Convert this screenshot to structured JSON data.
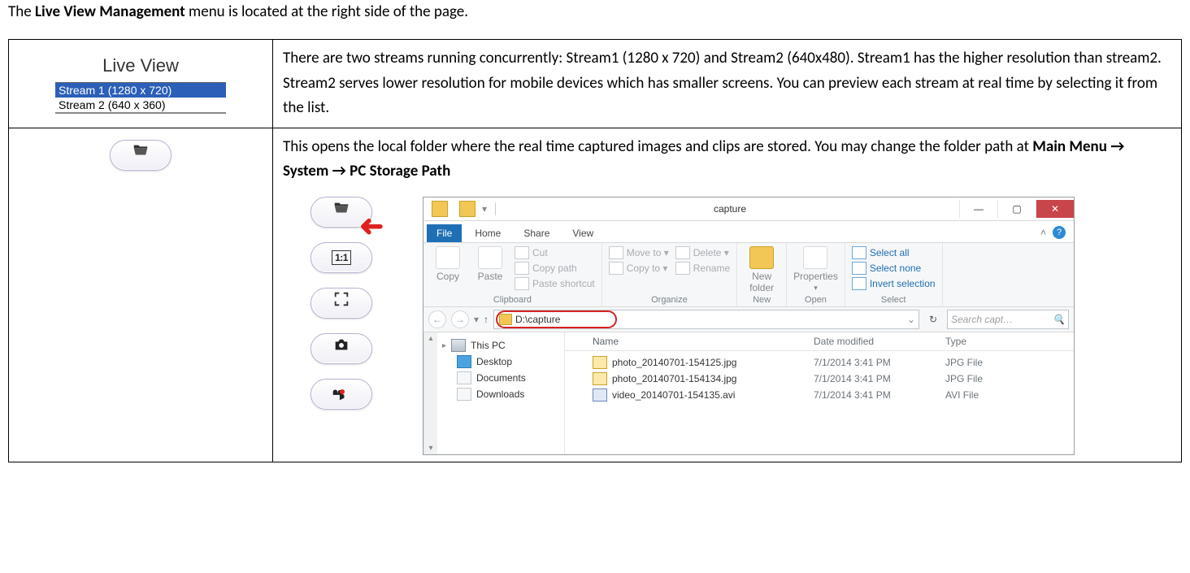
{
  "intro": {
    "pre": "The ",
    "bold": "Live View Management",
    "post": " menu is located at the right side of the page."
  },
  "live_view": {
    "title": "Live View",
    "items": [
      "Stream 1 (1280 x 720)",
      "Stream 2 (640 x 360)"
    ],
    "selected_index": 0
  },
  "row1_desc": "There are two streams running concurrently: Stream1 (1280 x 720) and Stream2 (640x480). Stream1 has the higher resolution than stream2. Stream2 serves lower resolution for mobile devices which has smaller screens. You can preview each stream at real time by selecting it from the list.",
  "row2_desc": {
    "pre": "This opens the local folder where the real time captured images and clips are stored. You may change the folder path at ",
    "bold": "Main Menu → System → PC Storage Path"
  },
  "ratio_label": "1:1",
  "explorer": {
    "window_title": "capture",
    "tabs": {
      "file": "File",
      "home": "Home",
      "share": "Share",
      "view": "View"
    },
    "ribbon": {
      "clipboard": {
        "copy": "Copy",
        "paste": "Paste",
        "cut": "Cut",
        "copypath": "Copy path",
        "pasteshortcut": "Paste shortcut",
        "group": "Clipboard"
      },
      "organize": {
        "moveto": "Move to ▾",
        "copyto": "Copy to ▾",
        "delete": "Delete ▾",
        "rename": "Rename",
        "group": "Organize"
      },
      "new": {
        "newfolder": "New\nfolder",
        "group": "New"
      },
      "open": {
        "properties": "Properties",
        "group": "Open"
      },
      "select": {
        "selectall": "Select all",
        "selectnone": "Select none",
        "invert": "Invert selection",
        "group": "Select"
      }
    },
    "path": "D:\\capture",
    "search_placeholder": "Search capt…",
    "nav_items": [
      "This PC",
      "Desktop",
      "Documents",
      "Downloads"
    ],
    "columns": {
      "name": "Name",
      "date": "Date modified",
      "type": "Type"
    },
    "files": [
      {
        "name": "photo_20140701-154125.jpg",
        "date": "7/1/2014 3:41 PM",
        "type": "JPG File",
        "kind": "jpg"
      },
      {
        "name": "photo_20140701-154134.jpg",
        "date": "7/1/2014 3:41 PM",
        "type": "JPG File",
        "kind": "jpg"
      },
      {
        "name": "video_20140701-154135.avi",
        "date": "7/1/2014 3:41 PM",
        "type": "AVI File",
        "kind": "avi"
      }
    ]
  }
}
